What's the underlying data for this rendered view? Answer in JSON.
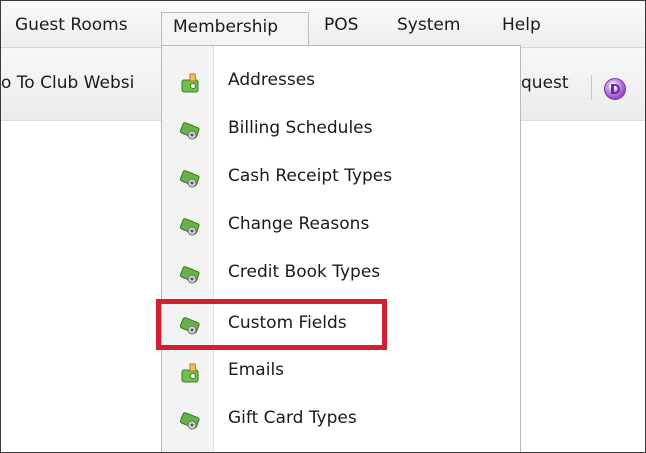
{
  "menubar": {
    "items": [
      {
        "label": "Guest Rooms"
      },
      {
        "label": "Membership"
      },
      {
        "label": "POS"
      },
      {
        "label": "System"
      },
      {
        "label": "Help"
      }
    ]
  },
  "toolbar": {
    "website_text": "o To Club Websi",
    "request_text": "quest",
    "icon": "circle-letter-icon"
  },
  "dropdown": {
    "items": [
      {
        "label": "Addresses",
        "icon": "wallet-hand-icon"
      },
      {
        "label": "Billing Schedules",
        "icon": "card-setting-icon"
      },
      {
        "label": "Cash Receipt Types",
        "icon": "card-setting-icon"
      },
      {
        "label": "Change Reasons",
        "icon": "card-setting-icon"
      },
      {
        "label": "Credit Book Types",
        "icon": "card-setting-icon"
      },
      {
        "label": "Custom Fields",
        "icon": "card-setting-icon"
      },
      {
        "label": "Emails",
        "icon": "wallet-hand-icon"
      },
      {
        "label": "Gift Card Types",
        "icon": "card-setting-icon"
      }
    ],
    "highlighted": "Custom Fields",
    "highlight_color": "#d11f2f"
  }
}
